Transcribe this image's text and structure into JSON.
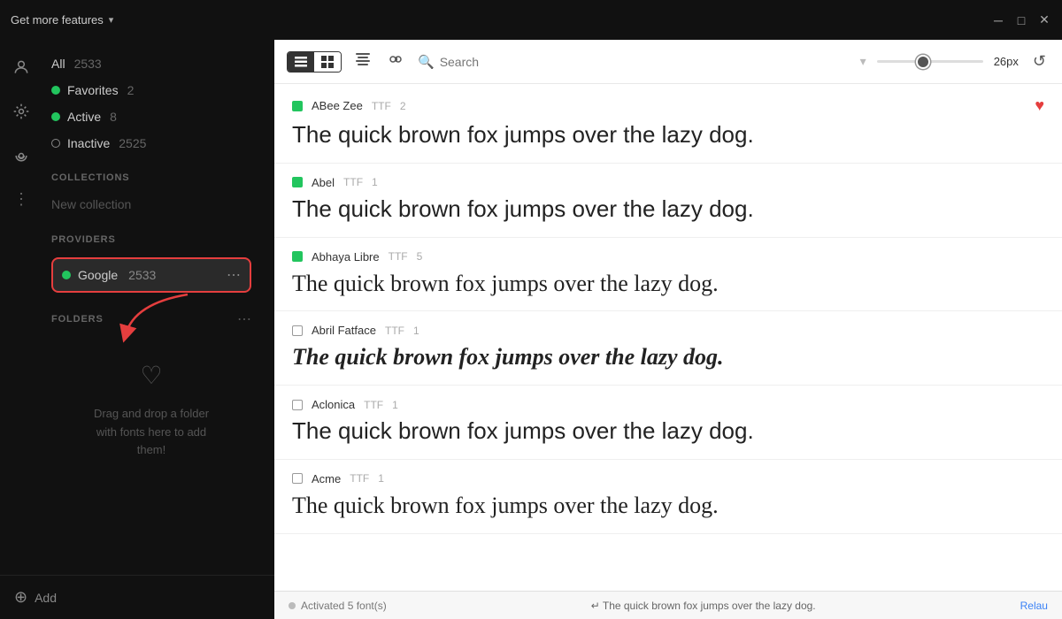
{
  "titlebar": {
    "title": "Get more features",
    "chevron": "▾",
    "minimize": "─",
    "maximize": "□",
    "close": "✕"
  },
  "sidebar": {
    "filters": [
      {
        "label": "All",
        "count": "2533",
        "dot": "none"
      },
      {
        "label": "Favorites",
        "count": "2",
        "dot": "green"
      },
      {
        "label": "Active",
        "count": "8",
        "dot": "green"
      },
      {
        "label": "Inactive",
        "count": "2525",
        "dot": "empty"
      }
    ],
    "collections_label": "COLLECTIONS",
    "new_collection": "New collection",
    "providers_label": "PROVIDERS",
    "google_label": "Google",
    "google_count": "2533",
    "folders_label": "FOLDERS",
    "folders_empty_text": "Drag and drop a folder\nwith fonts here to add\nthem!",
    "add_label": "Add"
  },
  "toolbar": {
    "search_placeholder": "Search",
    "font_size": "26px",
    "slider_value": 35
  },
  "fonts": [
    {
      "name": "ABee Zee",
      "format": "TTF",
      "variants": "2",
      "dot": "green",
      "preview": "The quick brown fox jumps over the lazy dog.",
      "favorited": true,
      "preview_style": "normal"
    },
    {
      "name": "Abel",
      "format": "TTF",
      "variants": "1",
      "dot": "green",
      "preview": "The quick brown fox jumps over the lazy dog.",
      "favorited": false,
      "preview_style": "normal"
    },
    {
      "name": "Abhaya Libre",
      "format": "TTF",
      "variants": "5",
      "dot": "green",
      "preview": "The quick brown fox jumps over the lazy dog.",
      "favorited": false,
      "preview_style": "normal"
    },
    {
      "name": "Abril Fatface",
      "format": "TTF",
      "variants": "1",
      "dot": "gray",
      "preview": "The quick brown fox jumps over the lazy dog.",
      "favorited": false,
      "preview_style": "bold"
    },
    {
      "name": "Aclonica",
      "format": "TTF",
      "variants": "1",
      "dot": "gray",
      "preview": "The quick brown fox jumps over the lazy dog.",
      "favorited": false,
      "preview_style": "impact"
    },
    {
      "name": "Acme",
      "format": "TTF",
      "variants": "1",
      "dot": "gray",
      "preview": "The quick brown fox jumps over the lazy dog.",
      "favorited": false,
      "preview_style": "normal"
    }
  ],
  "statusbar": {
    "activated_text": "Activated 5 font(s)",
    "center_text": "↵  The quick brown fox jumps over the lazy dog.",
    "right_text": "Relau"
  }
}
